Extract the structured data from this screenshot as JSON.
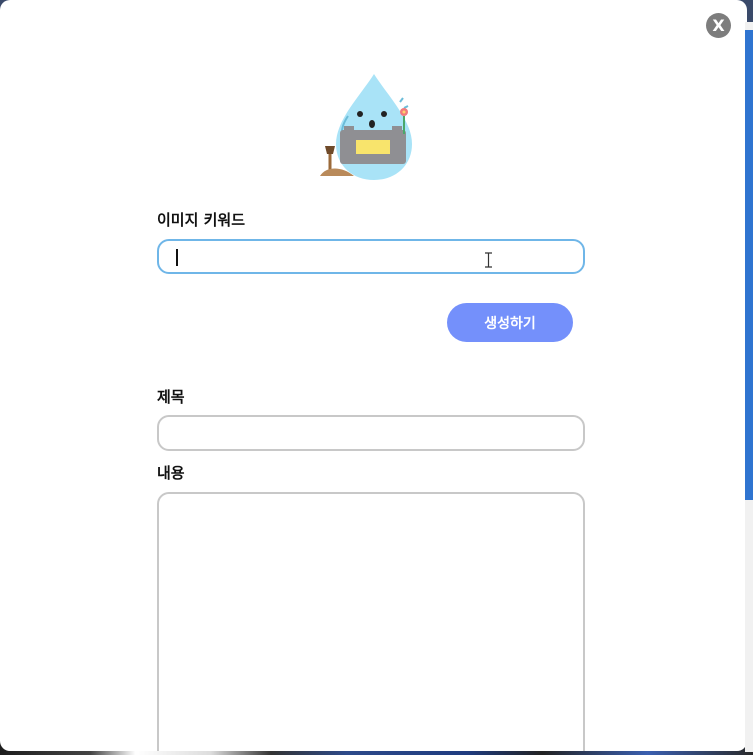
{
  "modal": {
    "close_label": "X",
    "mascot_icon": "water-drop-gardener-icon"
  },
  "form": {
    "keyword_label": "이미지 키워드",
    "keyword_value": "",
    "generate_label": "생성하기",
    "title_label": "제목",
    "title_value": "",
    "content_label": "내용",
    "content_value": ""
  },
  "colors": {
    "accent_button": "#7490fb",
    "focus_border": "#6fb6e8",
    "input_border": "#c8c8c8",
    "scrollbar": "#2f74d0"
  }
}
